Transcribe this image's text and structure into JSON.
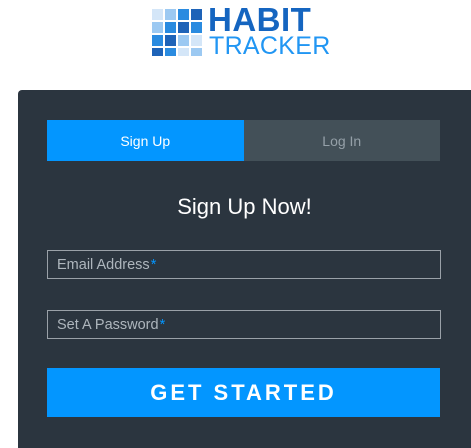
{
  "logo": {
    "word_main": "HABIT",
    "word_sub": "TRACKER",
    "icon": "grid-blocks-icon",
    "colors": {
      "main_text": "#1565c0",
      "sub_text": "#2196f3",
      "square_dark": "#1e63b8",
      "square_mid": "#2a8be0",
      "square_light": "#9cc9f2",
      "square_pale": "#d4e6f8"
    }
  },
  "tabs": [
    {
      "label": "Sign Up",
      "active": true
    },
    {
      "label": "Log In",
      "active": false
    }
  ],
  "form": {
    "title": "Sign Up Now!",
    "email_placeholder": "Email Address",
    "password_placeholder": "Set A Password",
    "required_marker": "*",
    "submit_label": "GET STARTED"
  },
  "colors": {
    "card_bg": "#2b353f",
    "accent": "#0396ff",
    "inactive_tab_bg": "#435058",
    "inactive_tab_text": "#95a0a8",
    "text": "#ffffff",
    "placeholder": "#aeb6bd"
  }
}
